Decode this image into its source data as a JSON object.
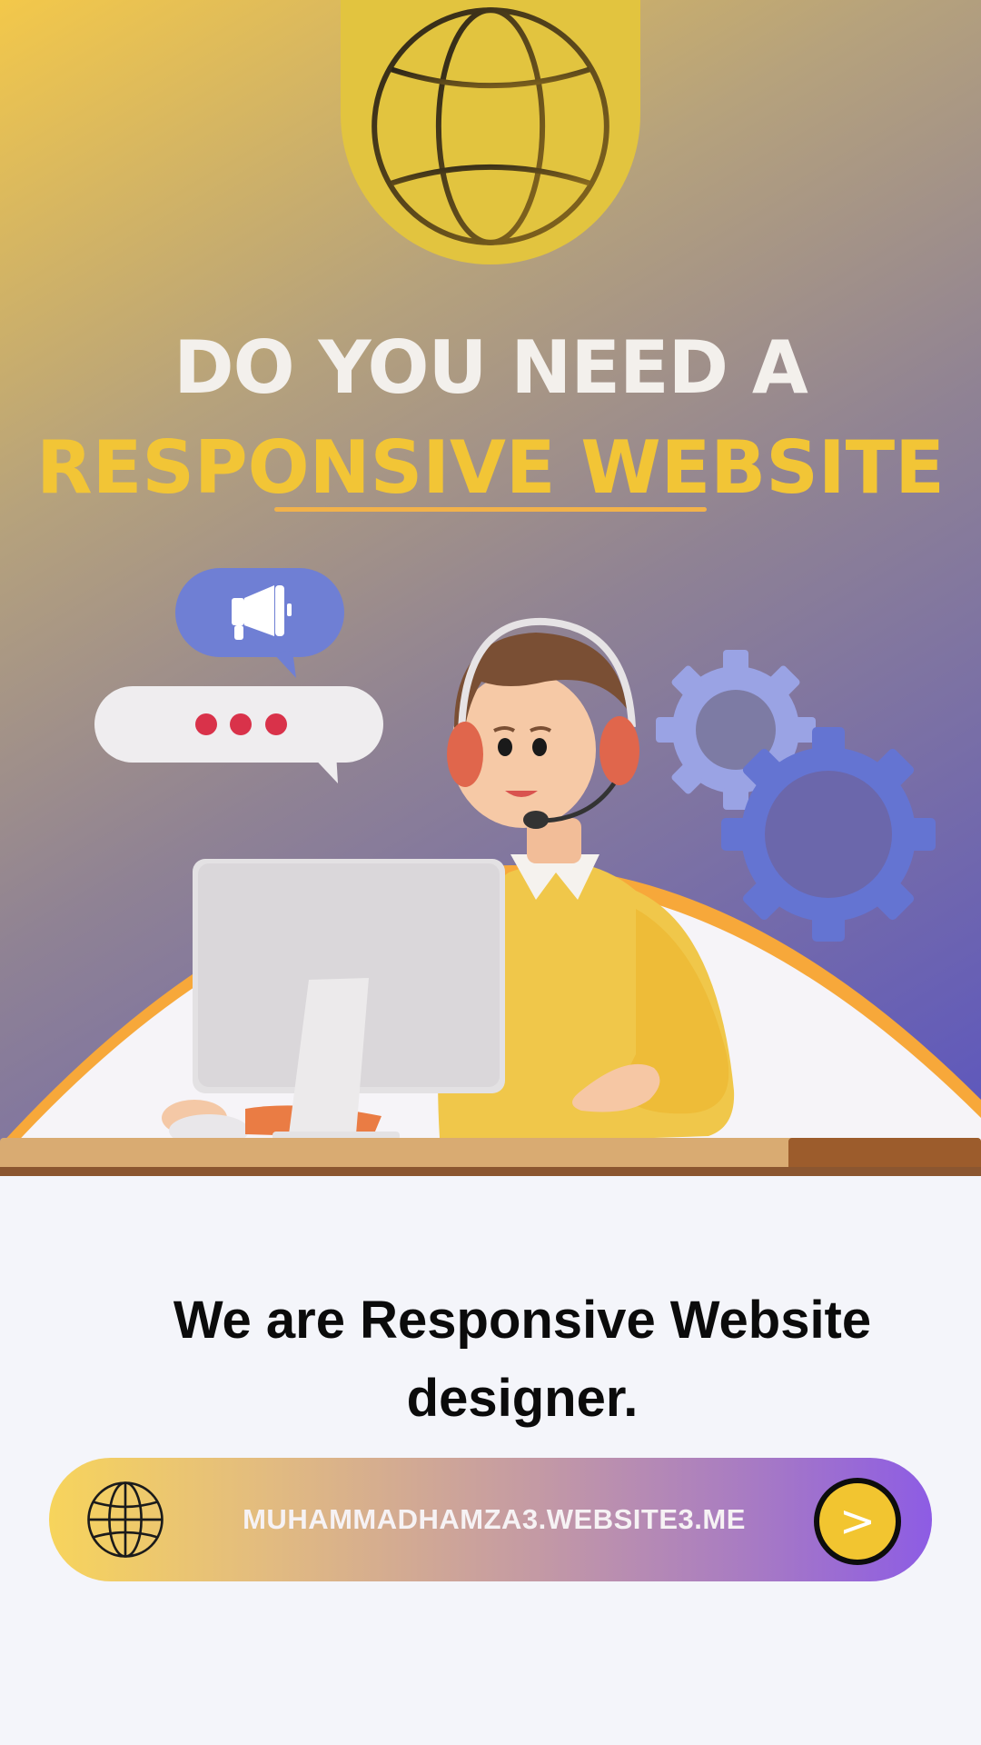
{
  "hero": {
    "headline_line1": "DO YOU NEED A",
    "headline_line2": "RESPONSIVE WEBSITE",
    "top_icon": "globe-icon",
    "illustration": {
      "character": "support-agent-with-headset",
      "props": [
        "desktop-monitor",
        "megaphone-speech-bubble",
        "typing-speech-bubble",
        "gears"
      ]
    }
  },
  "main": {
    "tagline": "We are Responsive Website designer."
  },
  "url_bar": {
    "icon": "globe-icon",
    "url": "MUHAMMADHAMZA3.WEBSITE3.ME",
    "go_label": ">"
  },
  "colors": {
    "headline_light": "#f3f0ec",
    "headline_accent": "#f2c536",
    "globe_tab": "#e2c43f",
    "gear": "#6b78d6",
    "arc": "#f7a83a",
    "button": "#f2c530"
  }
}
